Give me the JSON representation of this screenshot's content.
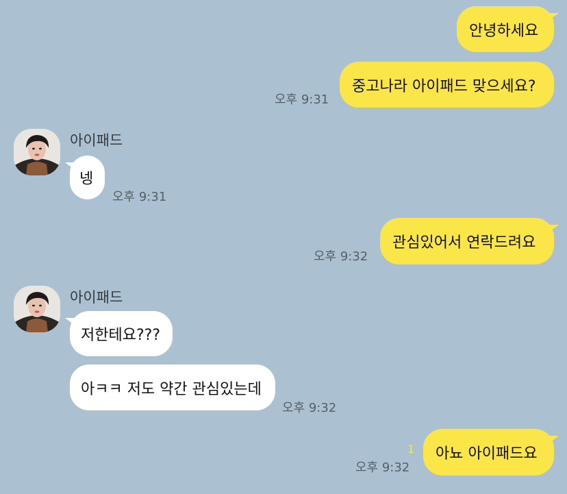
{
  "colors": {
    "background": "#abc1d1",
    "my_bubble": "#fbe649",
    "other_bubble": "#ffffff",
    "timestamp": "#555f66",
    "unread": "#fbe649"
  },
  "messages": {
    "m1": {
      "text": "안녕하세요"
    },
    "m2": {
      "text": "중고나라 아이패드 맞으세요?",
      "time": "오후 9:31"
    },
    "m3": {
      "sender": "아이패드",
      "text": "넹",
      "time": "오후 9:31"
    },
    "m4": {
      "text": "관심있어서 연락드려요",
      "time": "오후 9:32"
    },
    "m5": {
      "sender": "아이패드",
      "text": "저한테요???"
    },
    "m6": {
      "text": "아ㅋㅋ 저도 약간 관심있는데",
      "time": "오후 9:32"
    },
    "m7": {
      "text": "아뇨 아이패드요",
      "time": "오후 9:32",
      "unread": "1"
    }
  }
}
